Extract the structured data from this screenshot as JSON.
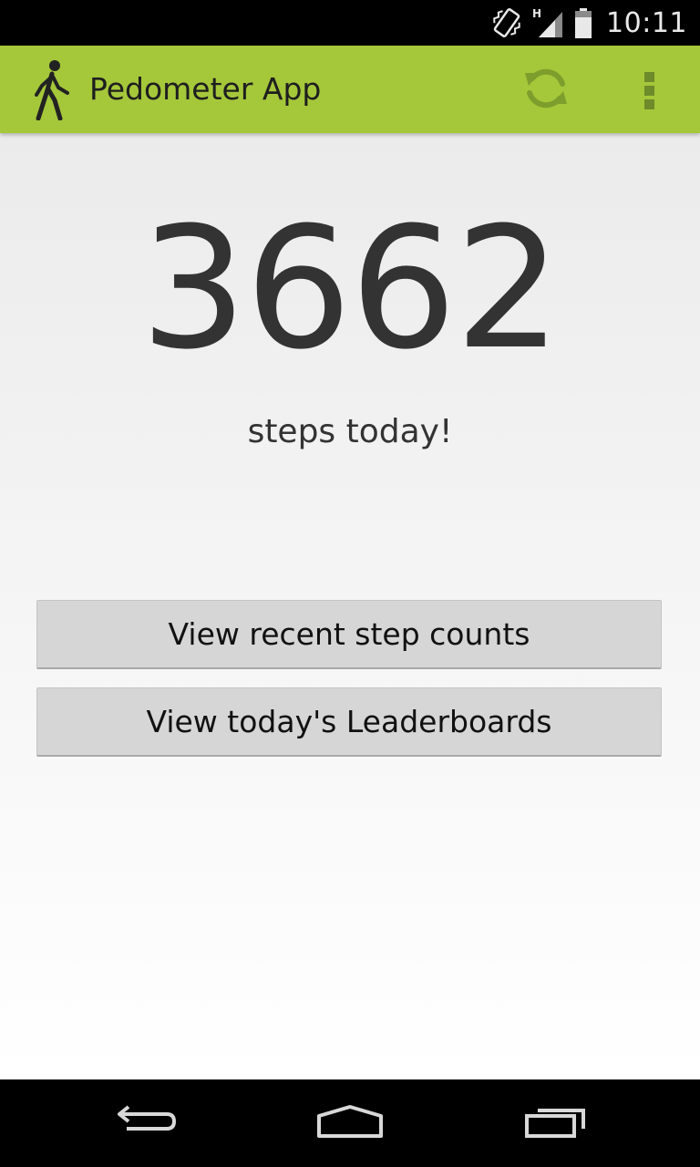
{
  "status_bar": {
    "time": "10:11",
    "network_type": "H",
    "icons": [
      "vibrate-icon",
      "signal-icon",
      "battery-icon"
    ]
  },
  "action_bar": {
    "title": "Pedometer App",
    "icon": "walking-person-icon",
    "actions": [
      "refresh-icon",
      "overflow-menu-icon"
    ],
    "color": "#a5c73a"
  },
  "main": {
    "step_count": "3662",
    "steps_label": "steps today!",
    "buttons": {
      "recent_label": "View recent step counts",
      "leaderboards_label": "View today's Leaderboards"
    }
  },
  "nav_bar": {
    "icons": [
      "back-icon",
      "home-icon",
      "recents-icon"
    ]
  }
}
